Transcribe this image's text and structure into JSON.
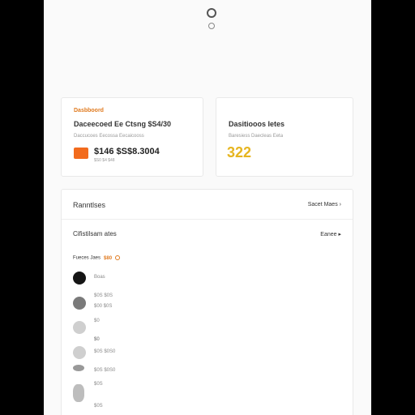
{
  "top_icons": [
    "settings-icon",
    "circle-icon"
  ],
  "cards": {
    "left": {
      "tag": "Dasbboord",
      "title": "Daceecoed Ee Ctsng $S4/30",
      "subtitle": "Daccucoes  Eecossa  Eecaicooss",
      "amount": "$146 $S$8.3004",
      "meta": "$S0 $4 $48",
      "logo_color": "#f26b1d"
    },
    "right": {
      "title": "Dasitiooos Ietes",
      "subtitle": "Baresiess  Daecleas  Eeta",
      "number": "322",
      "number_color": "#e6b520"
    }
  },
  "panel": {
    "title": "Ranntlses",
    "link": "Sacet Maes",
    "section_title": "Cifistilsam ates",
    "section_link": "Eanee",
    "filter_label": "Fueces Jaes",
    "filter_badge": "$80",
    "list": [
      {
        "type": "avatar",
        "text": "Boas"
      },
      {
        "type": "text",
        "text": "$0S  $0S"
      },
      {
        "type": "avatar",
        "text": "$00  $0S"
      },
      {
        "type": "text",
        "text": "$0"
      },
      {
        "type": "avatar",
        "text": "$0"
      },
      {
        "type": "text",
        "text": "$0"
      },
      {
        "type": "avatar",
        "text": "$0S  $0S0"
      },
      {
        "type": "text",
        "text": "$0S  $0S0"
      },
      {
        "type": "text",
        "text": "$0S"
      },
      {
        "type": "text",
        "text": "$0S"
      }
    ]
  }
}
